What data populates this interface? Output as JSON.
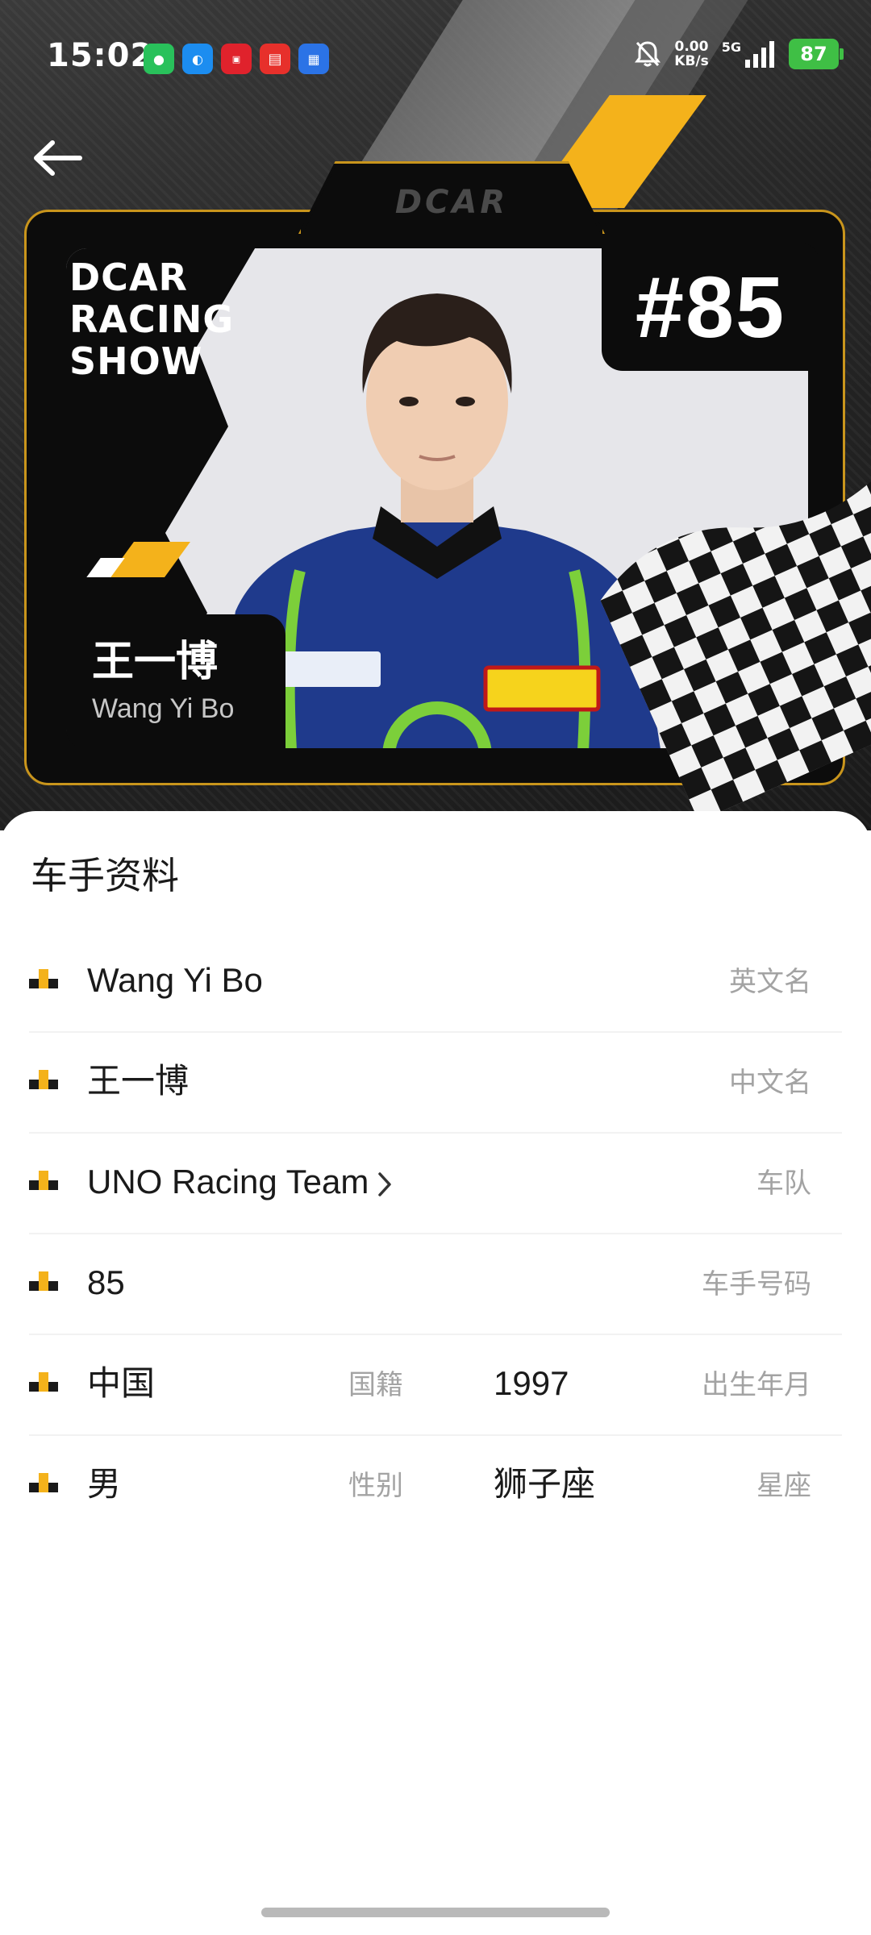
{
  "status_bar": {
    "time": "15:02",
    "net_speed_value": "0.00",
    "net_speed_unit": "KB/s",
    "network_type": "5G",
    "battery": "87",
    "notification_apps": [
      "wechat-icon",
      "qq-icon",
      "tmall-icon",
      "store-icon",
      "chat-icon"
    ]
  },
  "hero": {
    "brand_line1": "DCAR",
    "brand_line2": "RACING",
    "brand_line3": "SHOW",
    "card_logo": "DCAR",
    "driver_number": "#85",
    "driver_name_cn": "王一博",
    "driver_name_en": "Wang Yi Bo"
  },
  "profile": {
    "section_title": "车手资料",
    "rows": [
      {
        "value": "Wang Yi Bo",
        "label": "英文名"
      },
      {
        "value": "王一博",
        "label": "中文名"
      },
      {
        "value": "UNO Racing Team",
        "label": "车队"
      },
      {
        "value": "85",
        "label": "车手号码"
      },
      {
        "value": "中国",
        "label": "国籍",
        "value2": "1997",
        "label2": "出生年月"
      },
      {
        "value": "男",
        "label": "性别",
        "value2": "狮子座",
        "label2": "星座"
      }
    ]
  },
  "colors": {
    "accent_yellow": "#f4b21b",
    "card_border": "#c9951c",
    "label_gray": "#a3a3a3"
  }
}
